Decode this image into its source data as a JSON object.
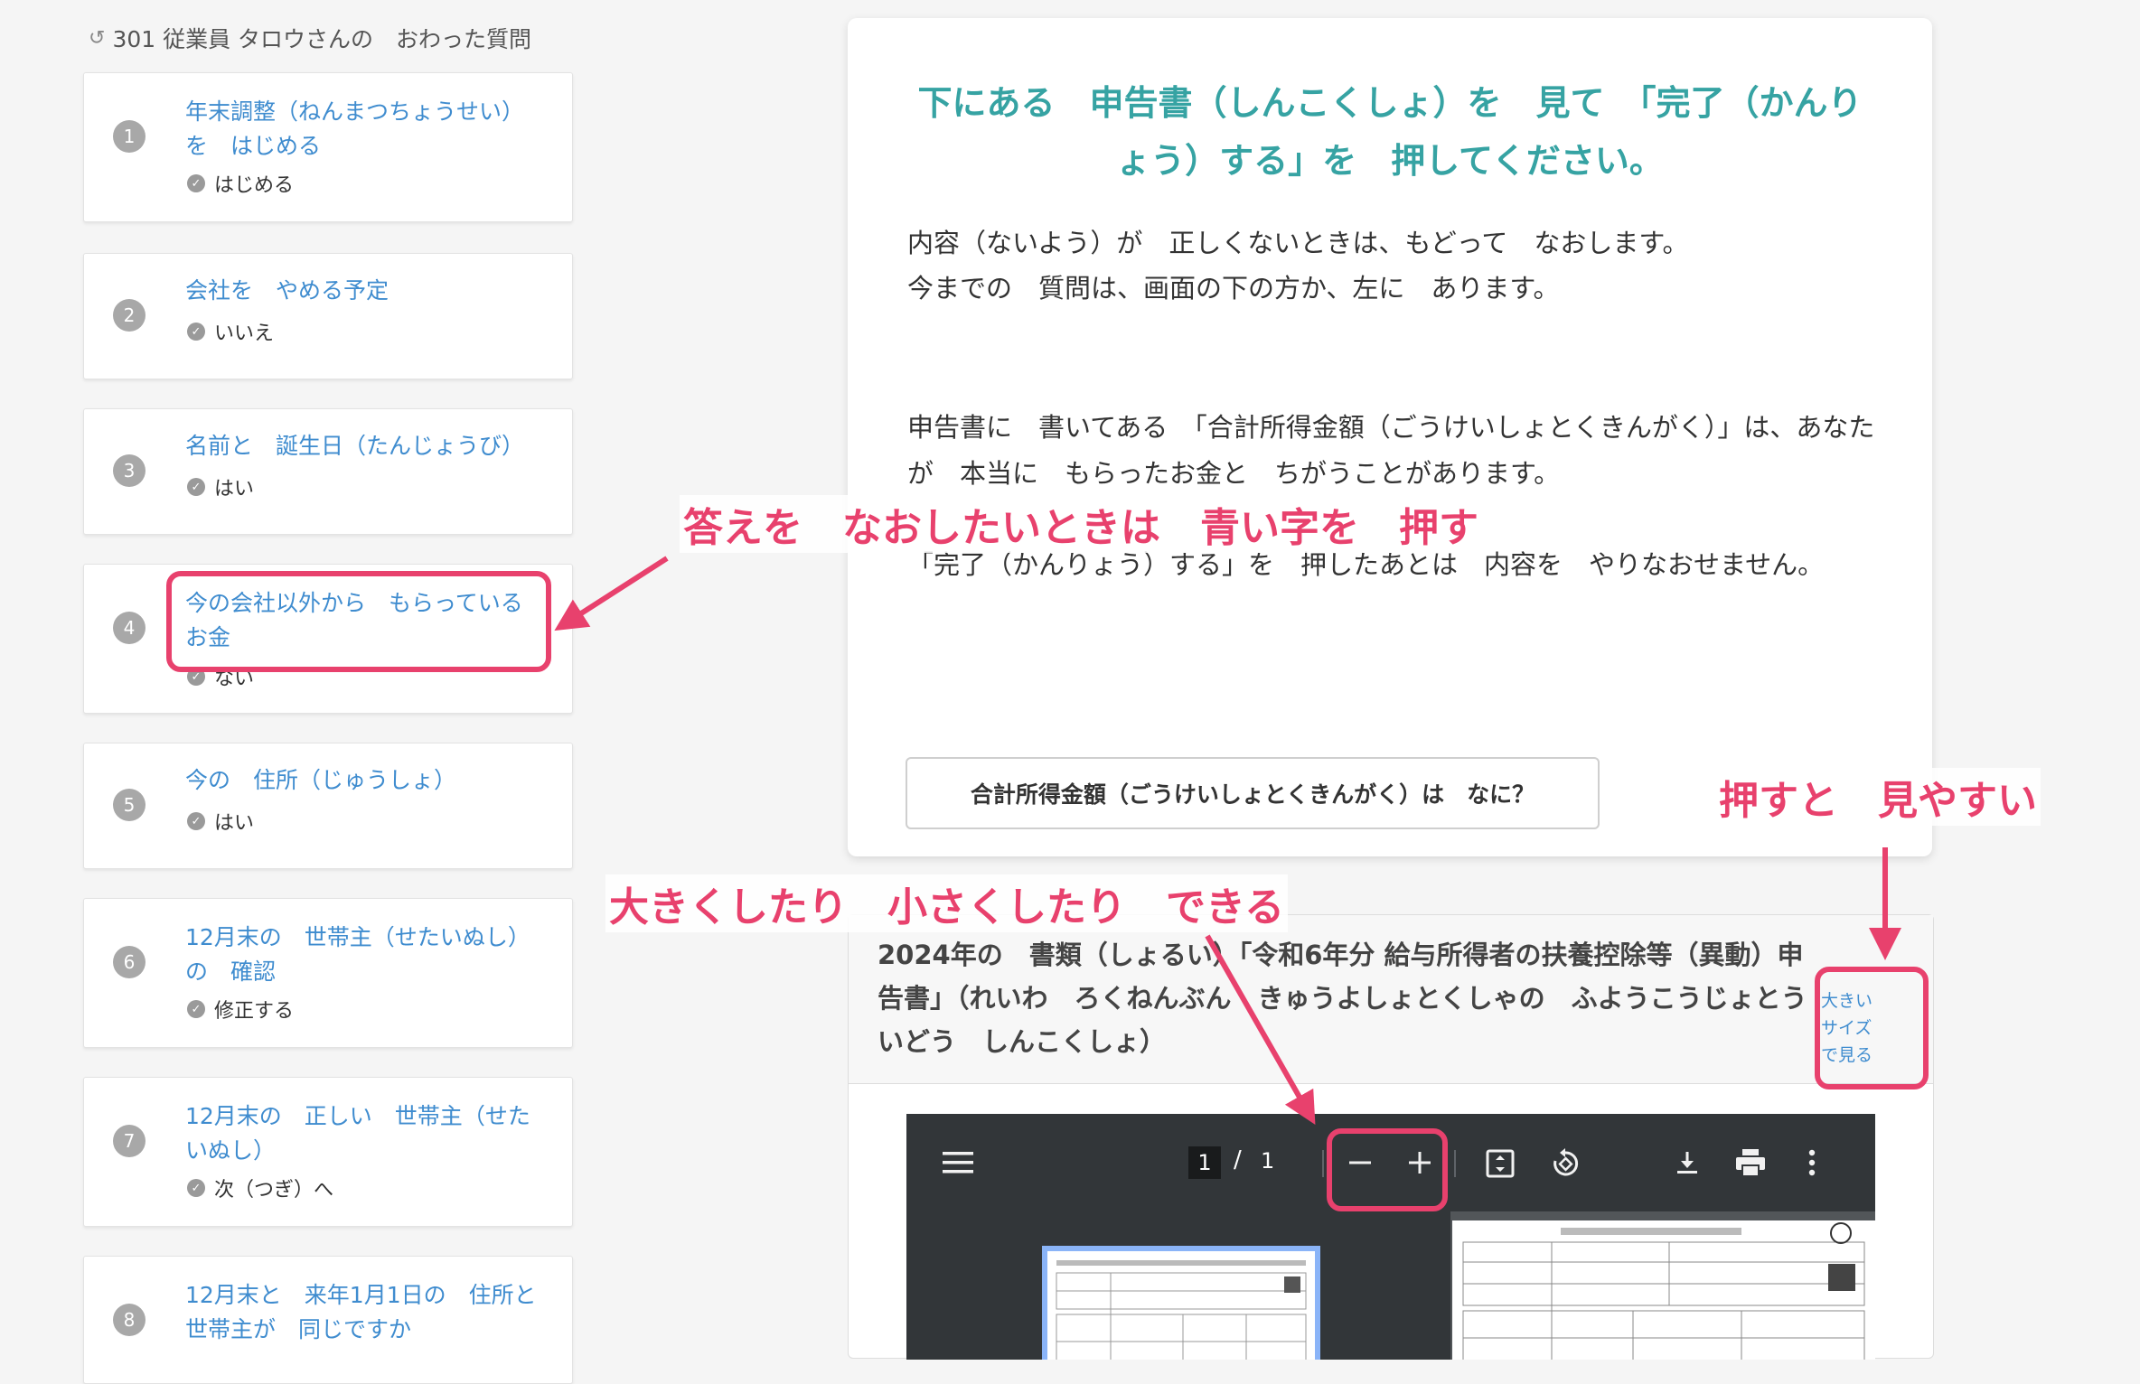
{
  "sidebar": {
    "title": "301 従業員 タロウさんの　おわった質問",
    "items": [
      {
        "num": "1",
        "question": "年末調整（ねんまつちょうせい）を　はじめる",
        "answer": "はじめる"
      },
      {
        "num": "2",
        "question": "会社を　やめる予定",
        "answer": "いいえ"
      },
      {
        "num": "3",
        "question": "名前と　誕生日（たんじょうび）",
        "answer": "はい"
      },
      {
        "num": "4",
        "question": "今の会社以外から　もらっているお金",
        "answer": "ない"
      },
      {
        "num": "5",
        "question": "今の　住所（じゅうしょ）",
        "answer": "はい"
      },
      {
        "num": "6",
        "question": "12月末の　世帯主（せたいぬし）の　確認",
        "answer": "修正する"
      },
      {
        "num": "7",
        "question": "12月末の　正しい　世帯主（せたいぬし）",
        "answer": "次（つぎ）へ"
      },
      {
        "num": "8",
        "question": "12月末と　来年1月1日の　住所と　世帯主が　同じですか",
        "answer": ""
      }
    ]
  },
  "main": {
    "heading": "下にある　申告書（しんこくしょ）を　見て　「完了（かんりょう）する」を　押してください。",
    "para1": "内容（ないよう）が　正しくないときは、もどって　なおします。",
    "para2": "今までの　質問は、画面の下の方か、左に　あります。",
    "para3": "申告書に　書いてある　「合計所得金額（ごうけいしょとくきんがく）」は、あなたが　本当に　もらったお金と　ちがうことがあります。",
    "para4": "「完了（かんりょう）する」を　押したあとは　内容を　やりなおせません。",
    "what_button": "合計所得金額（ごうけいしょとくきんがく）は　なに？"
  },
  "document": {
    "title": "2024年の　書類（しょるい）「令和6年分 給与所得者の扶養控除等（異動）申告書」（れいわ　ろくねんぶん　きゅうよしょとくしゃの　ふようこうじょとう　いどう　しんこくしょ）",
    "big_size_link": "大きいサイズで見る",
    "viewer": {
      "page_current": "1",
      "page_separator": "/",
      "page_total": "1",
      "icons": [
        "menu-icon",
        "zoom-out-icon",
        "zoom-in-icon",
        "fit-page-icon",
        "rotate-icon",
        "download-icon",
        "print-icon",
        "more-icon"
      ]
    }
  },
  "annotations": {
    "fix_answer": "答えを　なおしたいときは　青い字を　押す",
    "zoom": "大きくしたり　小さくしたり　できる",
    "press_easy": "押すと　見やすい"
  },
  "colors": {
    "accent_teal": "#36a3a3",
    "link_blue": "#3f8ccf",
    "annotation_pink": "#e8416d"
  }
}
